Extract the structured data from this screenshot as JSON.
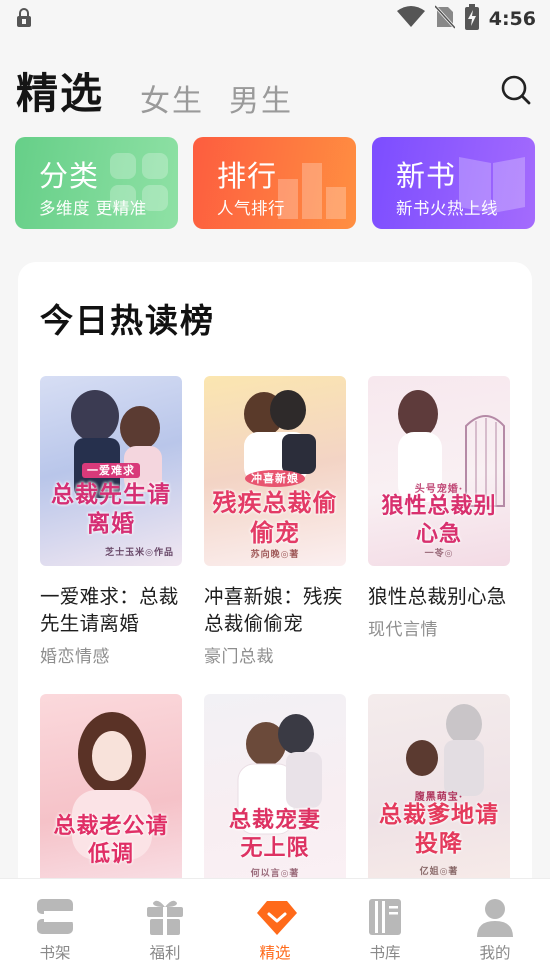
{
  "status_bar": {
    "time": "4:56",
    "icons": [
      "lock-icon",
      "wifi-icon",
      "no-sim-icon",
      "battery-charging-icon"
    ]
  },
  "header": {
    "tabs": [
      {
        "label": "精选",
        "active": true
      },
      {
        "label": "女生",
        "active": false
      },
      {
        "label": "男生",
        "active": false
      }
    ],
    "search_icon": "search-icon"
  },
  "tiles": [
    {
      "title": "分类",
      "subtitle": "多维度 更精准",
      "color": "#66cf88"
    },
    {
      "title": "排行",
      "subtitle": "人气排行",
      "color": "#fd5d3f"
    },
    {
      "title": "新书",
      "subtitle": "新书火热上线",
      "color": "#7c4dff"
    }
  ],
  "hot_list": {
    "title": "今日热读榜",
    "books": [
      {
        "name": "一爱难求：总裁先生请离婚",
        "tag": "婚恋情感",
        "cover_text": "总裁先生请离婚",
        "cover_top": "一爱难求",
        "cover_author": "芝士玉米◎作品"
      },
      {
        "name": "冲喜新娘：残疾总裁偷偷宠",
        "tag": "豪门总裁",
        "cover_text": "残疾总裁偷偷宠",
        "cover_top": "冲喜新娘",
        "cover_author": "苏向晚◎著"
      },
      {
        "name": "狼性总裁别心急",
        "tag": "现代言情",
        "cover_text": "狼性总裁别心急",
        "cover_top": "头号宠婚·",
        "cover_author": "一苓◎"
      },
      {
        "name": "",
        "tag": "",
        "cover_text": "总裁老公请低调",
        "cover_top": "",
        "cover_author": ""
      },
      {
        "name": "",
        "tag": "",
        "cover_text": "总裁宠妻无上限",
        "cover_top": "",
        "cover_author": "何以言◎著"
      },
      {
        "name": "",
        "tag": "",
        "cover_text": "总裁爹地请投降",
        "cover_top": "腹黑萌宝·",
        "cover_author": "亿姐◎著"
      }
    ]
  },
  "bottom_nav": [
    {
      "label": "书架",
      "icon": "bookshelf-icon",
      "active": false
    },
    {
      "label": "福利",
      "icon": "gift-icon",
      "active": false
    },
    {
      "label": "精选",
      "icon": "featured-diamond-icon",
      "active": true
    },
    {
      "label": "书库",
      "icon": "library-icon",
      "active": false
    },
    {
      "label": "我的",
      "icon": "profile-icon",
      "active": false
    }
  ],
  "colors": {
    "accent": "#ff6a1a",
    "inactive": "#8a8a8a",
    "nav_icon": "#b8b8b8"
  }
}
